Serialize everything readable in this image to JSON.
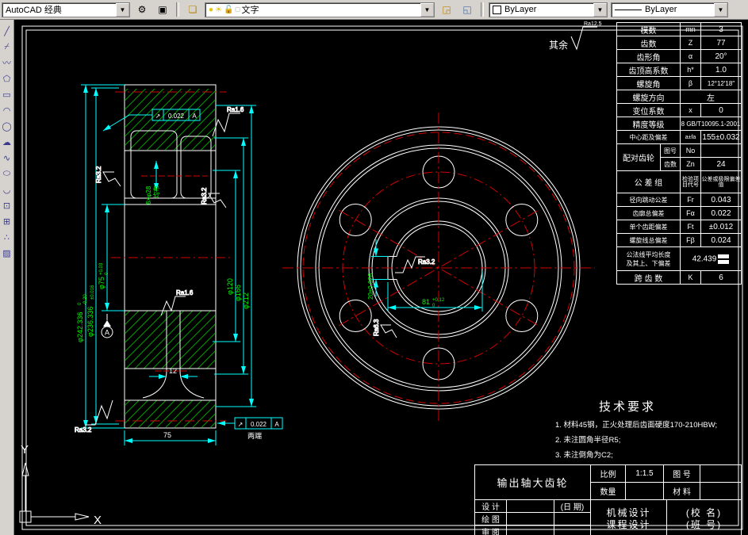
{
  "window": {
    "toolbar_bg": "#d6d3ce",
    "canvas_bg": "#000000",
    "dim_color": "#00ffff",
    "tol_text_color": "#00ff00",
    "centerline_color": "#d40000",
    "geometry_color": "#ffffff",
    "hatch_color": "#00b400"
  },
  "toolbar": {
    "workspace": "AutoCAD 经典",
    "layer_current": "文字",
    "color_current": "ByLayer",
    "linetype_current": "ByLayer",
    "dropdown_arrow": "▼"
  },
  "left_toolbar": {
    "glyphs": [
      "╱",
      "⌿",
      "〰",
      "⬠",
      "▭",
      "◠",
      "◯",
      "☁",
      "∿",
      "⬭",
      "◡",
      "⊡",
      "⊞",
      "∴",
      "▨"
    ]
  },
  "general_roughness": {
    "prefix": "其余",
    "value": "Ra12.5"
  },
  "section": {
    "d_tip": "φ242.336",
    "d_tip_sup": "0",
    "d_tip_sub": "-0.20",
    "d_ref": "φ236.336",
    "d_ref_tol": "±0.016",
    "d_bore": "φ75",
    "d_bore_sup": "+0.03",
    "d_bore_sub": "0",
    "d_hub": "φ120",
    "d_web": "φ166",
    "d_rim": "φ212",
    "web_w": "12",
    "face_w": "75",
    "holes_count": "6×φ28",
    "holes_note": "均布",
    "datum": "A"
  },
  "front": {
    "key_width": "20±0.026",
    "key_depth": "81",
    "key_depth_sup": "+0.12",
    "key_depth_sub": "0"
  },
  "tol_frame": {
    "sym": "↗",
    "value": "0.022",
    "datum": "A",
    "note": "两端"
  },
  "roughness": {
    "top": "Ra1.6",
    "left": "Ra3.2",
    "right": "Ra3.2",
    "web": "Ra1.6",
    "bottom": "Ra3.2",
    "key_top": "Ra3.2",
    "key_side": "Ra6.3"
  },
  "gear_table": {
    "rows": [
      {
        "label": "模数",
        "sym": "mn",
        "val": "3"
      },
      {
        "label": "齿数",
        "sym": "Z",
        "val": "77"
      },
      {
        "label": "齿形角",
        "sym": "α",
        "val": "20°"
      },
      {
        "label": "齿顶高系数",
        "sym": "h*",
        "val": "1.0"
      },
      {
        "label": "螺旋角",
        "sym": "β",
        "val": "12°12′18″"
      }
    ],
    "dir": {
      "label": "螺旋方向",
      "val": "左"
    },
    "shift": {
      "label": "变位系数",
      "sym": "x",
      "val": "0"
    },
    "acc": {
      "label": "精度等级",
      "val": "8 GB/T10095.1-2001"
    },
    "center": {
      "label": "中心距及偏差",
      "sym": "a±fa",
      "val": "155±0.032"
    },
    "pair": {
      "label": "配对齿轮",
      "r1l": "图号",
      "r1s": "No",
      "r1v": "",
      "r2l": "齿数",
      "r2s": "Zn",
      "r2v": "24"
    },
    "group": {
      "label": "公 差 组",
      "col1": "检验项目代号",
      "col2": "公差或极限偏差值"
    },
    "tol_rows": [
      {
        "label": "径向跳动公差",
        "sym": "Fr",
        "val": "0.043"
      },
      {
        "label": "齿廓总偏差",
        "sym": "Fα",
        "val": "0.022"
      },
      {
        "label": "单个齿距偏差",
        "sym": "Ft",
        "val": "±0.012"
      },
      {
        "label": "螺旋线总偏差",
        "sym": "Fβ",
        "val": "0.024"
      }
    ],
    "wk": {
      "label1": "公法线平均长度",
      "label2": "及其上、下偏差",
      "val": "42.439"
    },
    "span": {
      "label": "跨 齿 数",
      "sym": "K",
      "val": "6"
    }
  },
  "tech": {
    "title": "技术要求",
    "lines": [
      "1. 材料45钢，正火处理后齿面硬度170-210HBW;",
      "2. 未注圆角半径R5;",
      "3. 未注倒角为C2;"
    ]
  },
  "title_block": {
    "name": "输出轴大齿轮",
    "scale_label": "比例",
    "scale_val": "1:1.5",
    "qty_label": "数量",
    "qty_val": "",
    "no_label": "图 号",
    "no_val": "",
    "mat_label": "材 料",
    "mat_val": "",
    "design_label": "设 计",
    "draw_label": "绘 图",
    "check_label": "审 阅",
    "date_label": "(日 期)",
    "org1": "机械设计",
    "org2": "课程设计",
    "school": "(校 名)",
    "class": "(班 号)"
  },
  "ucs": {
    "x": "X",
    "y": "Y"
  }
}
